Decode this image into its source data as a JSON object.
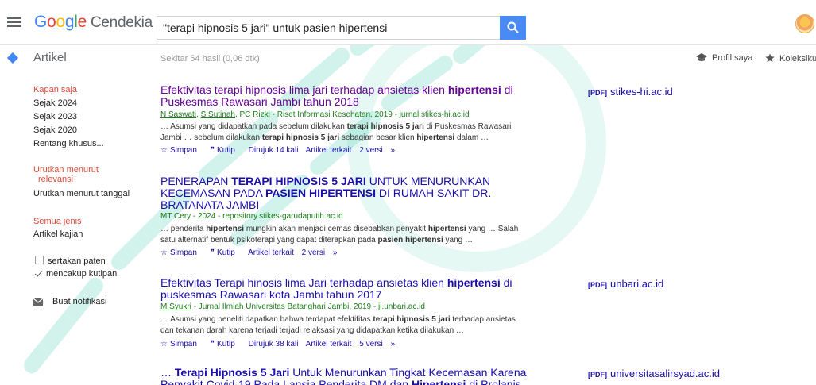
{
  "header": {
    "logo": {
      "g1": "G",
      "g2": "o",
      "g3": "o",
      "g4": "g",
      "g5": "l",
      "g6": "e",
      "rest": "Cendekia"
    },
    "search_value": "\"terapi hipnosis 5 jari\" untuk pasien hipertensi"
  },
  "subbar": {
    "section": "Artikel",
    "stats": "Sekitar 54 hasil (0,06 dtk)",
    "profile": "Profil saya",
    "library": "Koleksiku"
  },
  "sidebar": {
    "time": [
      "Kapan saja",
      "Sejak 2024",
      "Sejak 2023",
      "Sejak 2020",
      "Rentang khusus..."
    ],
    "sort_relevance_1": "Urutkan menurut",
    "sort_relevance_2": "relevansi",
    "sort_date": "Urutkan menurut tanggal",
    "all_types": "Semua jenis",
    "review_articles": "Artikel kajian",
    "include_patents": "sertakan paten",
    "include_citations": "mencakup kutipan",
    "create_alert": "Buat notifikasi"
  },
  "results": [
    {
      "title_1": "Efektivitas terapi hipnosis lima jari terhadap ansietas klien ",
      "title_b1": "hipertensi",
      "title_2": " di Puskesmas Rawasari Jambi tahun 2018",
      "authors_1": "N Saswati",
      "authors_sep": ", ",
      "authors_2": "S Sutinah",
      "authors_3": ", PC Rizki - Riset Informasi Kesehatan, 2019 - jurnal.stikes-hi.ac.id",
      "snip_1": "… Asumsi yang didapatkan pada sebelum dilakukan ",
      "snip_b1": "terapi hipnosis 5 jari",
      "snip_2": " di Puskesmas Rawasari Jambi … sebelum dilakukan ",
      "snip_b2": "terapi hipnosis 5 jari",
      "snip_3": " sebagian besar klien ",
      "snip_b3": "hipertensi",
      "snip_4": " dalam …",
      "save": "Simpan",
      "cite": "Kutip",
      "cited_by": "Dirujuk 14 kali",
      "related": "Artikel terkait",
      "versions": "2 versi",
      "pdf_tag": "[PDF]",
      "pdf_domain": "stikes-hi.ac.id"
    },
    {
      "title_1": "PENERAPAN ",
      "title_b1": "TERAPI HIPNOSIS 5 JARI",
      "title_2": " UNTUK MENURUNKAN KECEMASAN PADA ",
      "title_b2": "PASIEN HIPERTENSI",
      "title_3": " DI RUMAH SAKIT DR. BRATANATA JAMBI",
      "meta": "MT Cery - 2024 - repository.stikes-garudaputih.ac.id",
      "snip_1": "… penderita ",
      "snip_b1": "hipertensi",
      "snip_2": " mungkin akan menjadi cemas disebabkan penyakit ",
      "snip_b2": "hipertensi",
      "snip_3": " yang … Salah satu alternatif bentuk psikoterapi yang dapat diterapkan pada ",
      "snip_b3": "pasien hipertensi",
      "snip_4": " yang …",
      "save": "Simpan",
      "cite": "Kutip",
      "related": "Artikel terkait",
      "versions": "2 versi"
    },
    {
      "title_1": "Efektivitas Terapi hinosis lima Jari terhadap ansietas klien ",
      "title_b1": "hipertensi",
      "title_2": " di puskesmas Rawasari kota Jambi tahun 2017",
      "authors_1": "M Syukri",
      "authors_3": " - Jurnal Ilmiah Universitas Batanghari Jambi, 2019 - ji.unbari.ac.id",
      "snip_1": "… Asumsi yang peneliti dapatkan bahwa terdapat efektifitas ",
      "snip_b1": "terapi hipnosis 5 jari",
      "snip_2": " terhadap ansietas dan tekanan darah karena terjadi terjadi relaksasi yang didapatkan ketika dilakukan …",
      "save": "Simpan",
      "cite": "Kutip",
      "cited_by": "Dirujuk 38 kali",
      "related": "Artikel terkait",
      "versions": "5 versi",
      "pdf_tag": "[PDF]",
      "pdf_domain": "unbari.ac.id"
    },
    {
      "title_1": "… ",
      "title_b1": "Terapi Hipnosis 5 Jari",
      "title_2": " Untuk Menurunkan Tingkat Kecemasan Karena Penyakit Covid-19 Pada Lansia Penderita DM dan ",
      "title_b2": "Hipertensi",
      "title_3": " di Prolanis",
      "pdf_tag": "[PDF]",
      "pdf_domain": "universitasalirsyad.ac.id"
    }
  ],
  "icons": {
    "menu": "hamburger-menu-icon",
    "search": "magnifier-icon",
    "save": "star-outline-icon",
    "cite": "quote-icon",
    "more": "double-chevron-icon",
    "alert": "envelope-icon"
  },
  "colors": {
    "link": "#1a0dab",
    "visited": "#660099",
    "meta_green": "#1a7e1a",
    "active_red": "#dd4b39",
    "search_blue": "#4a8af4",
    "watermark": "#2fc9a2"
  }
}
